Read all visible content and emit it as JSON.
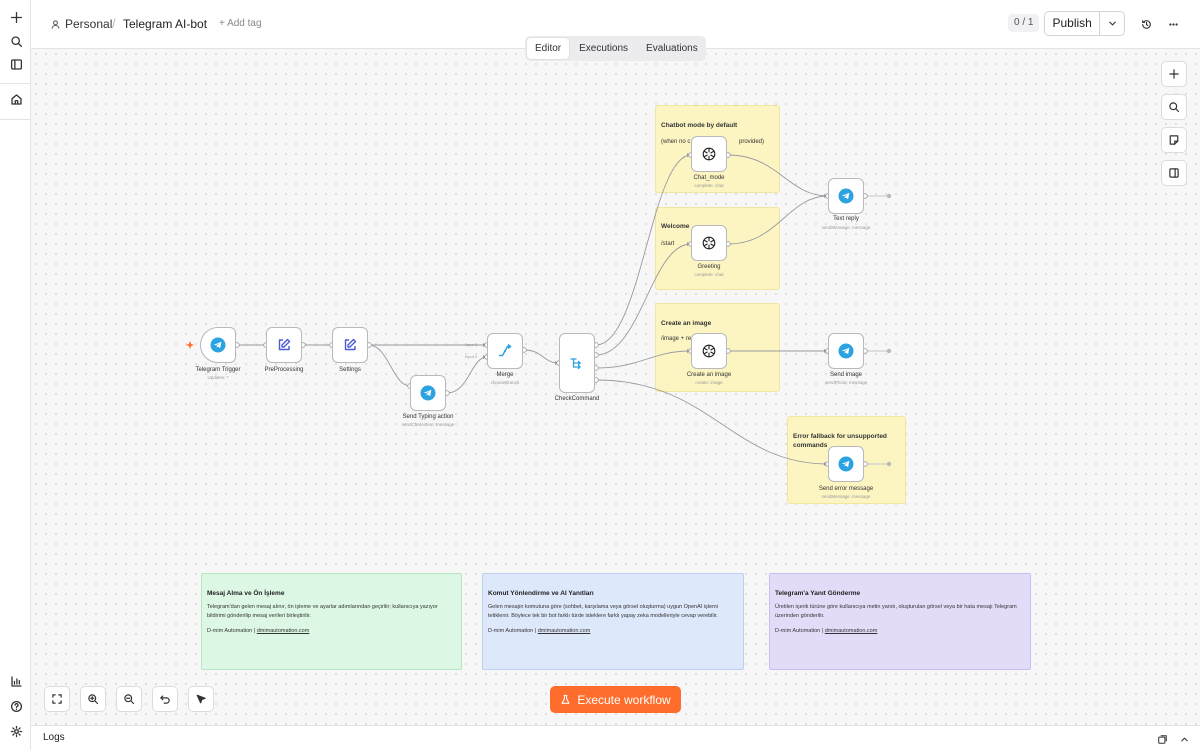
{
  "header": {
    "project": "Personal",
    "separator": "/",
    "workflow_name": "Telegram AI-bot",
    "add_tag": "+ Add tag",
    "counter": "0 / 1",
    "publish": "Publish"
  },
  "tabs": [
    "Editor",
    "Executions",
    "Evaluations"
  ],
  "active_tab": "Editor",
  "group_notes": {
    "chatbot": [
      "Chatbot mode by default",
      "(when no c",
      "provided)"
    ],
    "welcome": [
      "Welcome",
      "/start"
    ],
    "image": [
      "Create an image",
      "/image + re"
    ],
    "error": [
      "Error fallback for unsupported",
      "commands"
    ]
  },
  "nodes": {
    "trigger": {
      "name": "Telegram Trigger",
      "sub": "Updates: *"
    },
    "preprocessing": {
      "name": "PreProcessing",
      "sub": ""
    },
    "settings": {
      "name": "Settings",
      "sub": ""
    },
    "typing": {
      "name": "Send Typing action",
      "sub": "sendChatAction: message"
    },
    "merge": {
      "name": "Merge",
      "sub": "chooseBranch",
      "port1": "Input 1",
      "port2": "Input 2"
    },
    "check": {
      "name": "CheckCommand",
      "sub": ""
    },
    "chat_mode": {
      "name": "Chat_mode",
      "sub": "complete: chat"
    },
    "greeting": {
      "name": "Greeting",
      "sub": "complete: chat"
    },
    "create_image": {
      "name": "Create an image",
      "sub": "create: image"
    },
    "text_reply": {
      "name": "Text reply",
      "sub": "sendMessage: message"
    },
    "send_image": {
      "name": "Send image",
      "sub": "sendPhoto: message"
    },
    "send_error": {
      "name": "Send error message",
      "sub": "sendMessage: message"
    }
  },
  "stickies": [
    {
      "title": "Mesaj Alma ve Ön İşleme",
      "body": "Telegram'dan gelen mesaj alınır, ön işleme ve ayarlar adımlarından geçirilir; kullanıcıya yazıyor bildirimi gönderilip mesaj verileri birleştirilir.",
      "credit": "D-mim Automation",
      "link": "dmimautomation.com",
      "color": "#dcf7e3",
      "border": "#b8e6c4"
    },
    {
      "title": "Komut Yönlendirme ve AI Yanıtları",
      "body": "Gelen mesajın komutuna göre (sohbet, karşılama veya görsel oluşturma) uygun OpenAI işlemi tetiklenir. Böylece tek bir bot farklı türde isteklere farklı yapay zeka modelleriyle cevap verebilir.",
      "credit": "D-mim Automation",
      "link": "dmimautomation.com",
      "color": "#dde8fa",
      "border": "#bcd0f0"
    },
    {
      "title": "Telegram'a Yanıt Gönderme",
      "body": "Üretilen içerik türüne göre kullanıcıya metin yanıtı, oluşturulan görsel veya bir hata mesajı Telegram üzerinden gönderilir.",
      "credit": "D-mim Automation",
      "link": "dmimautomation.com",
      "color": "#e3dcf8",
      "border": "#c9bdf0"
    }
  ],
  "execute_button": "Execute workflow",
  "logs": "Logs",
  "icons": {
    "rail": [
      "plus-icon",
      "search-icon",
      "sidebar-toggle-icon",
      "home-icon",
      "insights-icon",
      "help-icon",
      "settings-icon"
    ],
    "canvas_right": [
      "add-node-icon",
      "search-nodes-icon",
      "sticky-note-icon",
      "panel-icon"
    ],
    "canvas_bottom": [
      "fit-view-icon",
      "zoom-in-icon",
      "zoom-out-icon",
      "undo-icon",
      "tidy-up-icon"
    ]
  },
  "colors": {
    "accent": "#ff6d2d",
    "telegram": "#2aa3e0",
    "edit_icon": "#4a5bd8",
    "note": "#fcf5c2"
  }
}
